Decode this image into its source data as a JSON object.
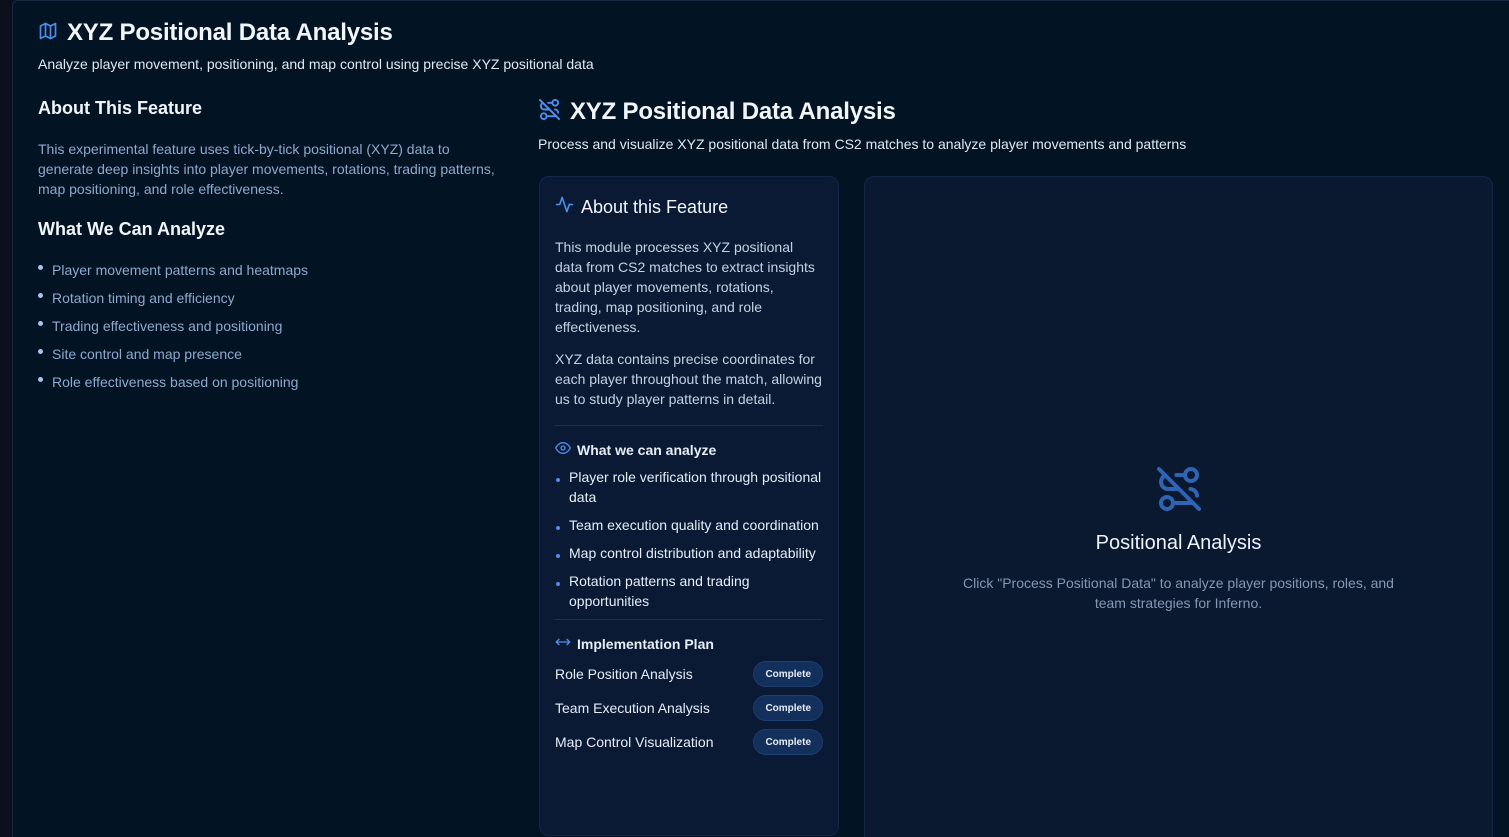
{
  "header": {
    "icon": "map-icon",
    "title": "XYZ Positional Data Analysis",
    "subtitle": "Analyze player movement, positioning, and map control using precise XYZ positional data"
  },
  "left": {
    "about_title": "About This Feature",
    "about_text": "This experimental feature uses tick-by-tick positional (XYZ) data to generate deep insights into player movements, rotations, trading patterns, map positioning, and role effectiveness.",
    "analyze_title": "What We Can Analyze",
    "items": [
      "Player movement patterns and heatmaps",
      "Rotation timing and efficiency",
      "Trading effectiveness and positioning",
      "Site control and map presence",
      "Role effectiveness based on positioning"
    ]
  },
  "right": {
    "icon": "route-off-icon",
    "title": "XYZ Positional Data Analysis",
    "subtitle": "Process and visualize XYZ positional data from CS2 matches to analyze player movements and patterns"
  },
  "card": {
    "title": "About this Feature",
    "p1": "This module processes XYZ positional data from CS2 matches to extract insights about player movements, rotations, trading, map positioning, and role effectiveness.",
    "p2": "XYZ data contains precise coordinates for each player throughout the match, allowing us to study player patterns in detail.",
    "analyze_heading": "What we can analyze",
    "analyze_items": [
      "Player role verification through positional data",
      "Team execution quality and coordination",
      "Map control distribution and adaptability",
      "Rotation patterns and trading opportunities"
    ],
    "plan_heading": "Implementation Plan",
    "plan": [
      {
        "label": "Role Position Analysis",
        "status": "Complete"
      },
      {
        "label": "Team Execution Analysis",
        "status": "Complete"
      },
      {
        "label": "Map Control Visualization",
        "status": "Complete"
      }
    ]
  },
  "panel": {
    "title": "Positional Analysis",
    "text": "Click \"Process Positional Data\" to analyze player positions, roles, and team strategies for Inferno."
  },
  "colors": {
    "background": "#021324",
    "card": "#0a1a34",
    "accent": "#4d8ff0",
    "muted_text": "#8fa9cc"
  }
}
